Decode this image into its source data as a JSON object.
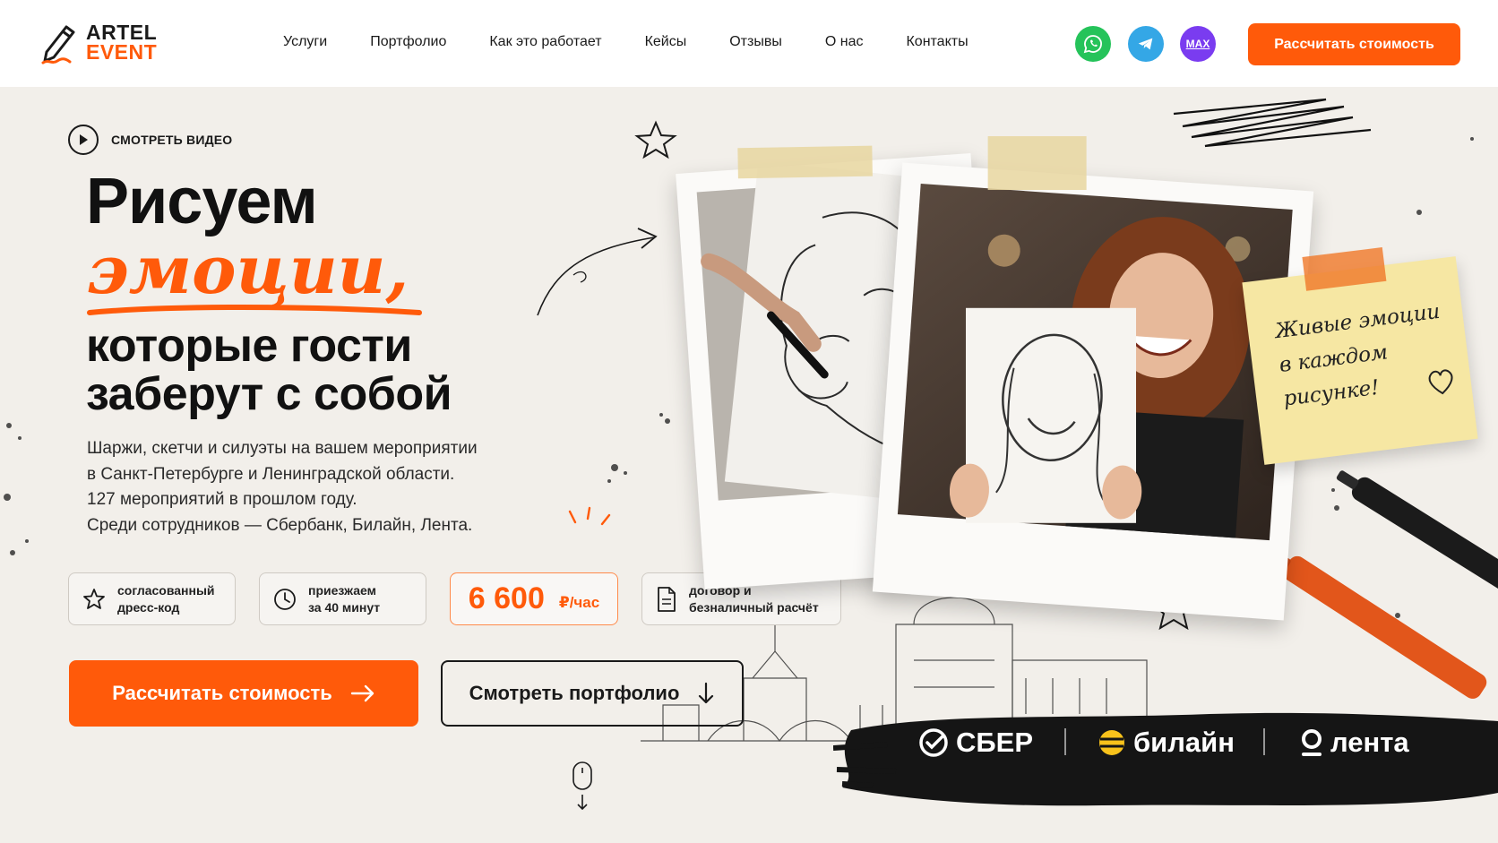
{
  "header": {
    "logo": {
      "line1": "ARTEL",
      "line2": "EVENT"
    },
    "nav": [
      {
        "label": "Услуги"
      },
      {
        "label": "Портфолио"
      },
      {
        "label": "Как это работает"
      },
      {
        "label": "Кейсы"
      },
      {
        "label": "Отзывы"
      },
      {
        "label": "О нас"
      },
      {
        "label": "Контакты"
      }
    ],
    "social": [
      {
        "icon": "whatsapp-icon",
        "color": "#25c35a"
      },
      {
        "icon": "telegram-icon",
        "color": "#34a7e6"
      },
      {
        "icon": "max-icon",
        "label": "MAX",
        "color": "#7a3cf0"
      }
    ],
    "cta_label": "Рассчитать стоимость"
  },
  "hero": {
    "watch_video": "СМОТРЕТЬ ВИДЕО",
    "title_line1": "Рисуем",
    "title_accent": "эмоции,",
    "title_line3": "которые гости",
    "title_line4": "заберут с собой",
    "lead": [
      "Шаржи, скетчи и силуэты на вашем мероприятии",
      "в Санкт-Петербурге и Ленинградской области.",
      "127 мероприятий в прошлом году.",
      "Среди сотрудников — Сбербанк, Билайн, Лента."
    ],
    "chips": {
      "dress_code": {
        "line1": "согласованный",
        "line2": "дресс-код",
        "icon": "star-icon"
      },
      "arrival": {
        "line1": "приезжаем",
        "line2": "за 40 минут",
        "icon": "clock-icon"
      },
      "price": {
        "value": "6 600",
        "unit": "₽/час"
      },
      "contract": {
        "line1": "договор и",
        "line2": "безналичный расчёт",
        "icon": "document-icon"
      }
    },
    "cta_primary": "Рассчитать стоимость",
    "cta_secondary": "Смотреть портфолио",
    "sticky_note": [
      "Живые эмоции",
      "в каждом",
      "рисунке!"
    ],
    "clients": [
      {
        "name": "СБЕР",
        "icon": "sber-logo-icon"
      },
      {
        "name": "билайн",
        "icon": "beeline-logo-icon"
      },
      {
        "name": "лента",
        "icon": "lenta-logo-icon"
      }
    ]
  },
  "colors": {
    "accent": "#ff5a0a",
    "text": "#1a1a1a",
    "background": "#f2efea"
  }
}
